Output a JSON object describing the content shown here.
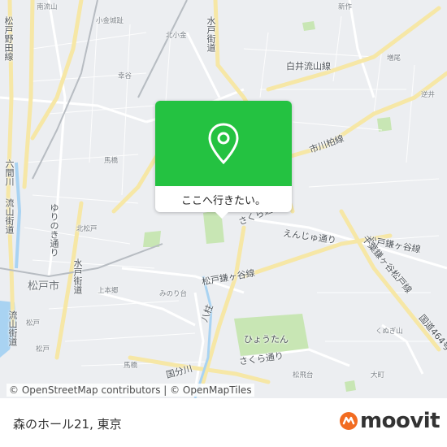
{
  "popup": {
    "label": "ここへ行きたい。"
  },
  "attribution": "© OpenStreetMap contributors | © OpenMapTiles",
  "footer": {
    "place": "森のホール21, 東京",
    "brand": "moovit"
  },
  "colors": {
    "accent_green": "#24c241",
    "brand_orange": "#f26c21",
    "park": "#c8e6b4",
    "road": "#ffffff",
    "highway": "#f4e6a8"
  },
  "map_labels": {
    "nagareyama_top": "南流山",
    "shinsaku": "新作",
    "kogane_castle": "小金城趾",
    "kitakogane": "北小金",
    "matsudo_noda": "松戸野田線",
    "mito_hwy": "水戸街道",
    "kouya": "幸谷",
    "shiraiyama": "白井流山線",
    "masuo": "増尾",
    "sakai": "逆井",
    "ichikawa_kashiwa": "市川柏線",
    "mabashi": "馬橋",
    "rokkenyama": "六間川",
    "nagareyama_hwy": "流山街道",
    "yurinoki": "ゆりのき通り",
    "kitamatsudo": "北松戸",
    "sakura_dori": "さくら通り",
    "enjyu": "えんじゅ通り",
    "matsudo_kamagaya": "松戸鎌ヶ谷線",
    "matsudo_kamagaya_right": "松戸鎌ヶ谷線",
    "chiba_kamagaya": "千葉鎌ヶ谷松戸線",
    "matsudo_city": "松戸市",
    "kamihongo": "上本郷",
    "minorinodai": "みのり台",
    "matsudo": "松戸",
    "nagareyama_hwy2": "流山街道",
    "hachiman": "八柱",
    "hyoutan": "ひょうたん",
    "sakura_dori2": "さくら通り",
    "kokubun": "国分川",
    "matsudo_st": "松戸",
    "mabashi2": "馬橋",
    "kunugiyama": "くぬぎ山",
    "kokudo464": "国道464号",
    "matsuhidai": "松飛台",
    "daimachi": "大町"
  }
}
